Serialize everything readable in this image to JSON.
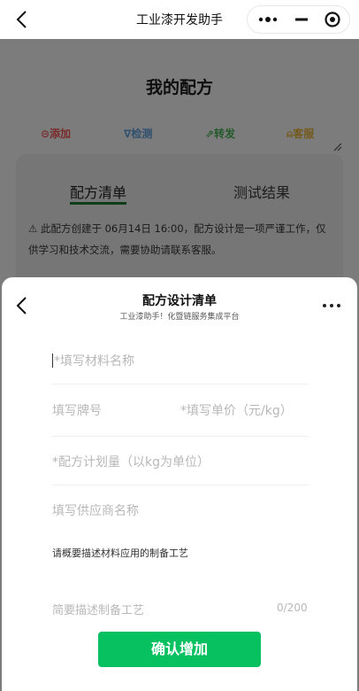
{
  "navbar": {
    "title": "工业漆开发助手"
  },
  "background_page": {
    "title": "我的配方",
    "actions": [
      {
        "icon": "plus-circle-icon",
        "label": "⊝添加"
      },
      {
        "icon": "funnel-icon",
        "label": "∇检测"
      },
      {
        "icon": "forward-icon",
        "label": "⇗转发"
      },
      {
        "icon": "service-icon",
        "label": "⍝客服"
      }
    ],
    "tabs": [
      "配方清单",
      "测试结果"
    ],
    "active_tab": "配方清单",
    "notice": "⚠ 此配方创建于 06月14日 16:00，配方设计是一项严谨工作，仅供学习和技术交流，需要协助请联系客服。"
  },
  "sheet": {
    "title": "配方设计清单",
    "subtitle": "工业漆助手！化暨链服务集成平台",
    "form": {
      "material_placeholder": "*填写材料名称",
      "brand_placeholder": "填写牌号",
      "price_placeholder": "*填写单价（元/kg）",
      "plan_placeholder": "*配方计划量（以kg为单位）",
      "supplier_placeholder": "填写供应商名称",
      "process_label": "请概要描述材料应用的制备工艺",
      "process_placeholder": "简要描述制备工艺",
      "process_counter": "0/200"
    },
    "confirm_label": "确认增加"
  },
  "colors": {
    "accent": "#07c160",
    "overlay": "#7a7a7a",
    "tab_underline": "#0b3d18"
  }
}
